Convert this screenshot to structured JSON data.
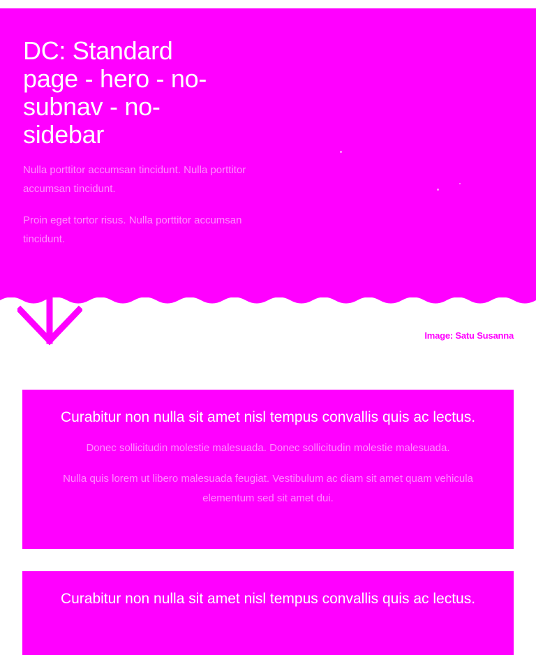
{
  "hero": {
    "title": "DC: Standard page - hero - no-subnav - no-sidebar",
    "paragraphs": [
      "Nulla porttitor accumsan tincidunt. Nulla porttitor accumsan tincidunt.",
      "Proin eget tortor risus. Nulla porttitor accumsan tincidunt."
    ],
    "image_credit": "Image: Satu Susanna",
    "scroll_icon": "arrow-down-icon"
  },
  "cards": [
    {
      "title": "Curabitur non nulla sit amet nisl tempus convallis quis ac lectus.",
      "paragraphs": [
        "Donec sollicitudin molestie malesuada. Donec sollicitudin molestie malesuada.",
        "Nulla quis lorem ut libero malesuada feugiat. Vestibulum ac diam sit amet quam vehicula elementum sed sit amet dui."
      ]
    },
    {
      "title": "Curabitur non nulla sit amet nisl tempus convallis quis ac lectus."
    }
  ],
  "colors": {
    "brand": "#ff00ff",
    "text_on_brand": "#ffffff"
  }
}
